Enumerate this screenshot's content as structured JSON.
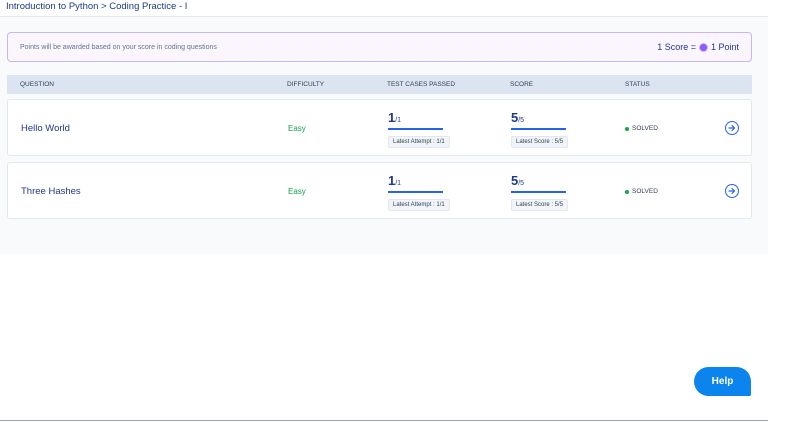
{
  "breadcrumb": "Introduction to Python > Coding Practice - I",
  "banner": {
    "text": "Points will be awarded based on your score in coding questions",
    "score_label": "1 Score =",
    "point_label": "1 Point",
    "coin_icon": "coin-icon"
  },
  "table": {
    "headers": {
      "question": "QUESTION",
      "difficulty": "DIFFICULTY",
      "test_cases": "TEST CASES PASSED",
      "score": "SCORE",
      "status": "STATUS"
    },
    "rows": [
      {
        "question": "Hello World",
        "difficulty": "Easy",
        "passed_big": "1",
        "passed_small": "/1",
        "passed_attempt": "Latest Attempt : 1/1",
        "score_big": "5",
        "score_small": "/5",
        "score_latest": "Latest Score : 5/5",
        "status": "SOLVED"
      },
      {
        "question": "Three Hashes",
        "difficulty": "Easy",
        "passed_big": "1",
        "passed_small": "/1",
        "passed_attempt": "Latest Attempt : 1/1",
        "score_big": "5",
        "score_small": "/5",
        "score_latest": "Latest Score : 5/5",
        "status": "SOLVED"
      }
    ]
  },
  "help_label": "Help",
  "colors": {
    "accent": "#2563eb",
    "easy": "#16a34a",
    "help": "#0b84ee"
  }
}
